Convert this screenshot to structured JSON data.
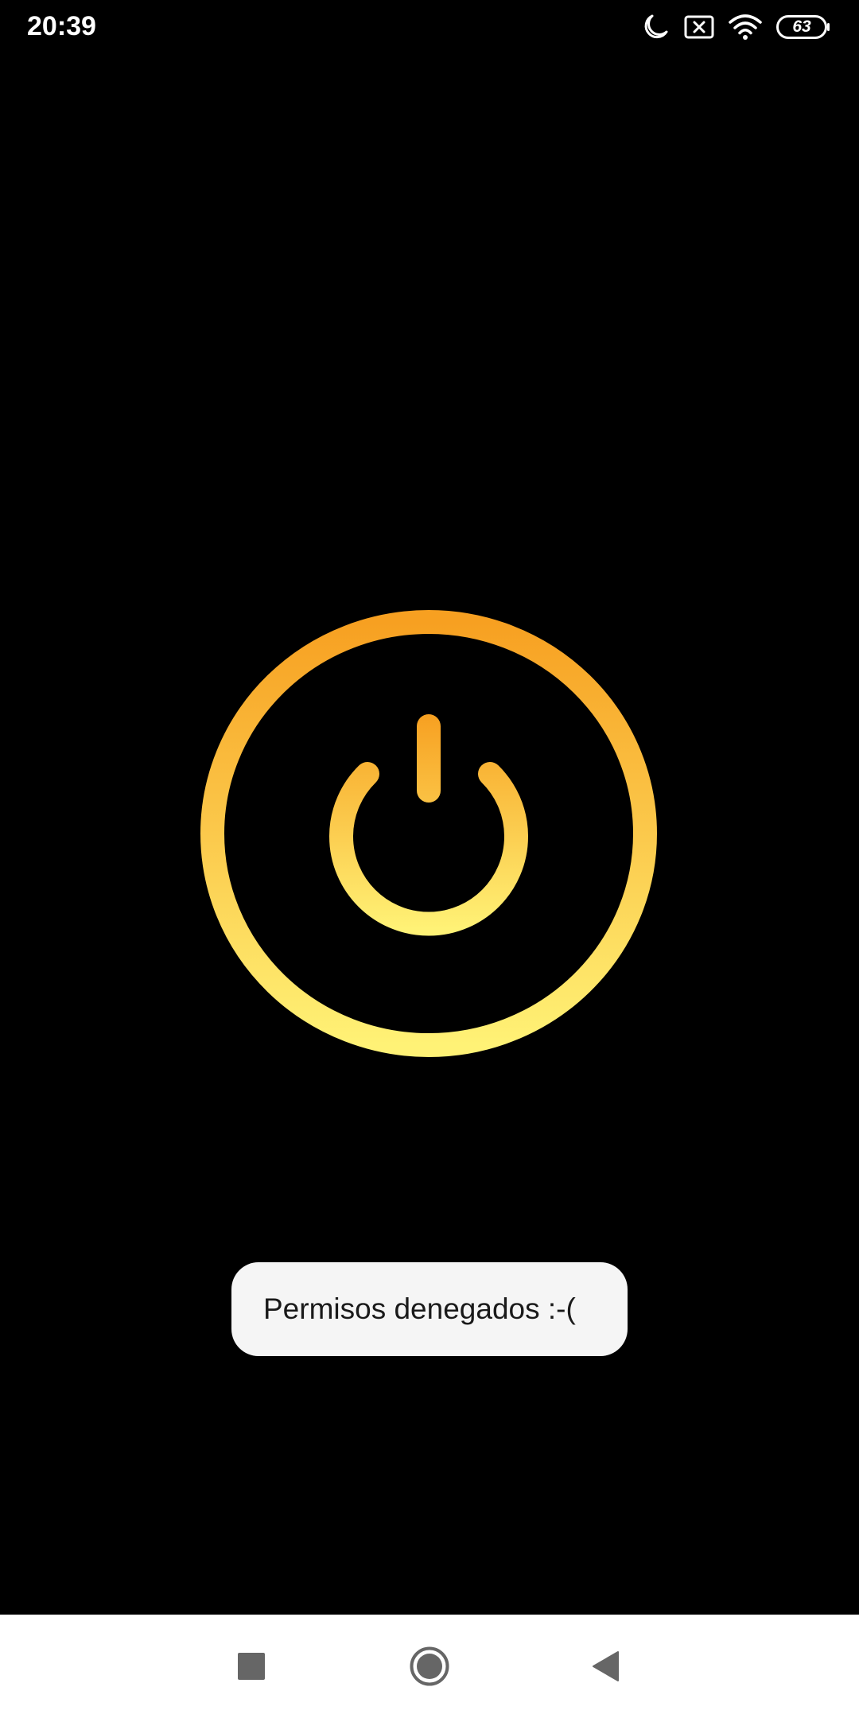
{
  "status_bar": {
    "time": "20:39",
    "icons": [
      "moon-icon",
      "notification-x-icon",
      "wifi-icon",
      "battery-icon"
    ],
    "battery_level": "63"
  },
  "power_button": {
    "icon": "power-icon",
    "gradient_top": "#F7A021",
    "gradient_bottom": "#FFF276"
  },
  "toast": {
    "message": "Permisos denegados :-("
  },
  "nav_bar": {
    "buttons": [
      "recents-icon",
      "home-icon",
      "back-icon"
    ]
  },
  "colors": {
    "background": "#000000",
    "toast_background": "#F5F5F5",
    "nav_background": "#FFFFFF",
    "nav_icon": "#666666"
  }
}
